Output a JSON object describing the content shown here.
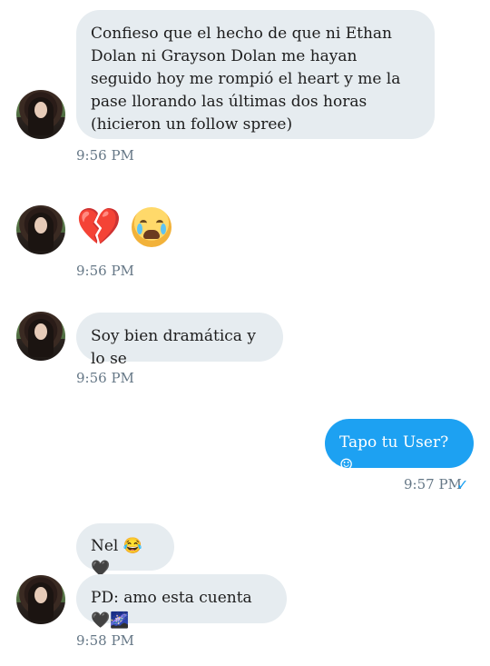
{
  "messages": [
    {
      "text": "Confieso que el hecho de que ni Ethan Dolan ni Grayson Dolan me hayan seguido hoy me rompió el heart y me la pase llorando las últimas dos horas (hicieron un follow spree)",
      "time": "9:56 PM"
    },
    {
      "emoji_1": "💔",
      "emoji_2": "😭",
      "time": "9:56 PM"
    },
    {
      "text": "Soy bien dramática y lo se",
      "time": "9:56 PM"
    },
    {
      "text": "Tapo tu User? ☺",
      "time": "9:57 PM",
      "status_icon": "checkmark-icon"
    },
    {
      "text": "Nel 😂🖤"
    },
    {
      "text": "PD: amo esta cuenta 🖤🌌",
      "time": "9:58 PM"
    }
  ],
  "colors": {
    "received_bubble": "#e6ecf0",
    "sent_bubble": "#1da1f2",
    "timestamp": "#657786"
  }
}
